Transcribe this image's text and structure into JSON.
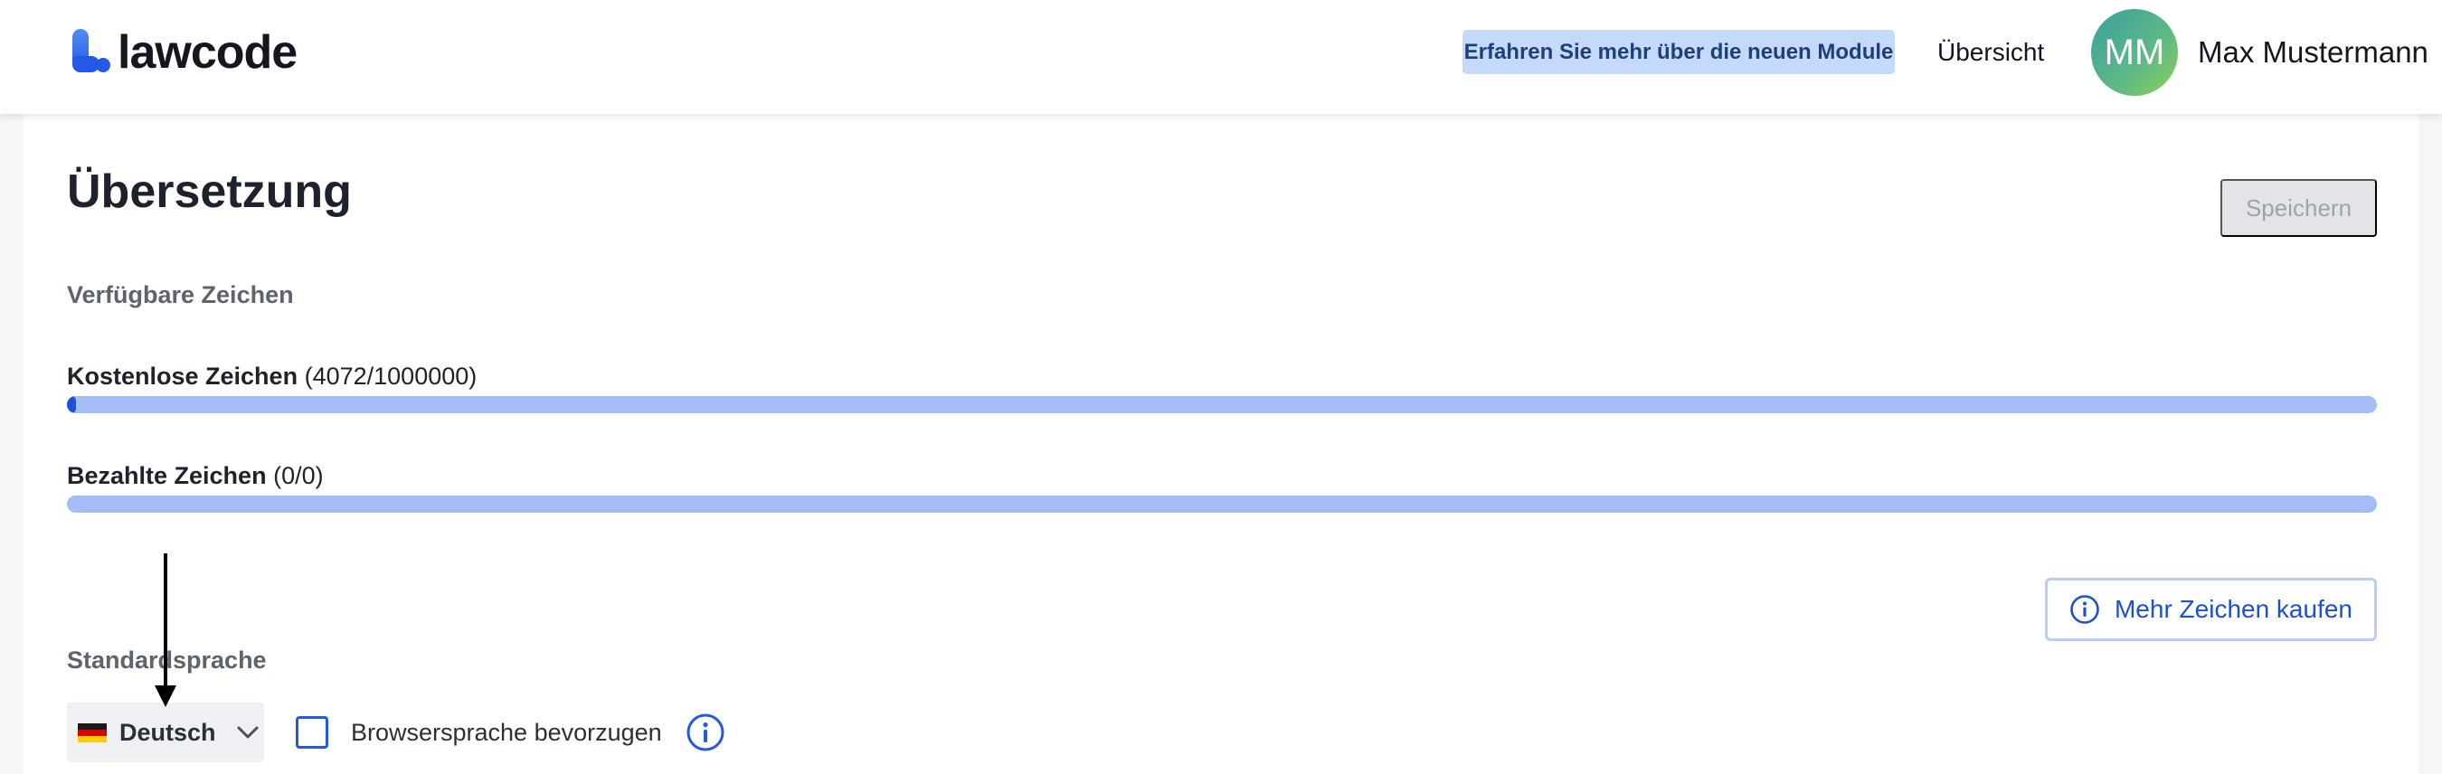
{
  "header": {
    "logo_text": "lawcode",
    "promo_label": "Erfahren Sie mehr über die neuen Module",
    "overview_label": "Übersicht",
    "avatar_initials": "MM",
    "user_name": "Max Mustermann"
  },
  "page": {
    "title": "Übersetzung",
    "save_label": "Speichern",
    "available_label": "Verfügbare Zeichen",
    "free": {
      "label": "Kostenlose Zeichen",
      "count": "(4072/1000000)",
      "used": 4072,
      "total": 1000000
    },
    "paid": {
      "label": "Bezahlte Zeichen",
      "count": "(0/0)",
      "used": 0,
      "total": 0
    },
    "buy_label": "Mehr Zeichen kaufen",
    "default_language_label": "Standardsprache",
    "selected_language": "Deutsch",
    "prefer_browser_label": "Browsersprache bevorzugen",
    "prefer_browser_checked": false
  },
  "colors": {
    "accent": "#2458e6",
    "progress_track": "#a5bdf6",
    "promo_bg": "#c4d9fb",
    "save_disabled_bg": "#e2e4e8"
  },
  "icons": {
    "buy": "info-circle-icon",
    "browser_info": "info-circle-icon",
    "dropdown": "chevron-down-icon",
    "flag": "german-flag-icon"
  }
}
